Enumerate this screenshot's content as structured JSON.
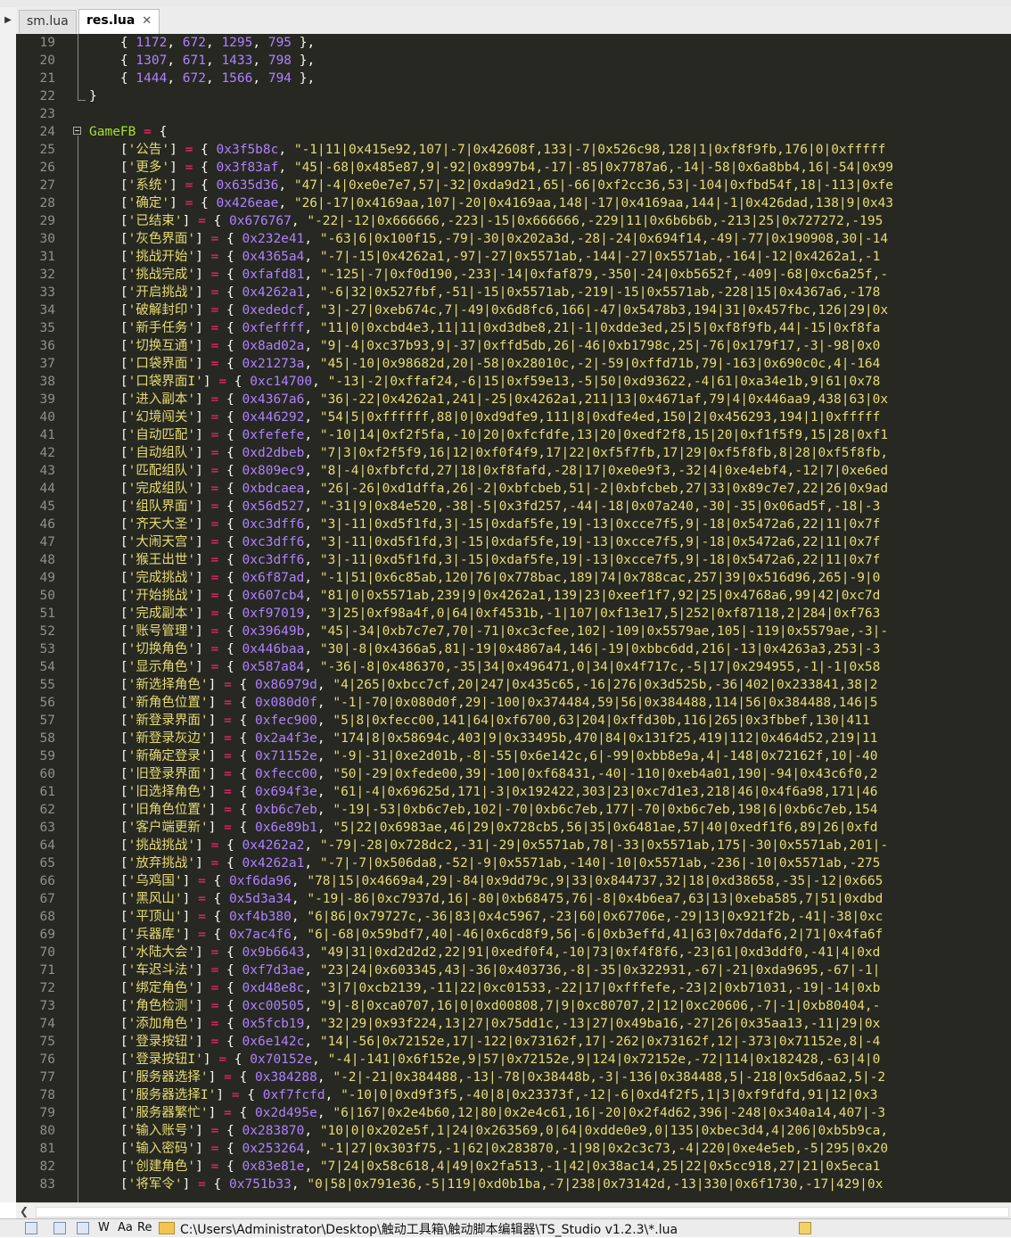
{
  "tabs": [
    {
      "label": "sm.lua",
      "active": false
    },
    {
      "label": "res.lua",
      "active": true,
      "close": "✕"
    }
  ],
  "editor": {
    "lines": [
      {
        "n": "19",
        "t": "    { 1172, 672, 1295, 795 },"
      },
      {
        "n": "20",
        "t": "    { 1307, 671, 1433, 798 },"
      },
      {
        "n": "21",
        "t": "    { 1444, 672, 1566, 794 },"
      },
      {
        "n": "22",
        "t": "}"
      },
      {
        "n": "23",
        "t": ""
      },
      {
        "n": "24",
        "t": "GameFB = {"
      },
      {
        "n": "25",
        "t": "    ['公告'] = { 0x3f5b8c, \"-1|11|0x415e92,107|-7|0x42608f,133|-7|0x526c98,128|1|0xf8f9fb,176|0|0xfffff"
      },
      {
        "n": "26",
        "t": "    ['更多'] = { 0x3f83af, \"45|-68|0x485e87,9|-92|0x8997b4,-17|-85|0x7787a6,-14|-58|0x6a8bb4,16|-54|0x99"
      },
      {
        "n": "27",
        "t": "    ['系统'] = { 0x635d36, \"47|-4|0xe0e7e7,57|-32|0xda9d21,65|-66|0xf2cc36,53|-104|0xfbd54f,18|-113|0xfe"
      },
      {
        "n": "28",
        "t": "    ['确定'] = { 0x426eae, \"26|-17|0x4169aa,107|-20|0x4169aa,148|-17|0x4169aa,144|-1|0x426dad,138|9|0x43"
      },
      {
        "n": "29",
        "t": "    ['已结束'] = { 0x676767, \"-22|-12|0x666666,-223|-15|0x666666,-229|11|0x6b6b6b,-213|25|0x727272,-195"
      },
      {
        "n": "30",
        "t": "    ['灰色界面'] = { 0x232e41, \"-63|6|0x100f15,-79|-30|0x202a3d,-28|-24|0x694f14,-49|-77|0x190908,30|-14"
      },
      {
        "n": "31",
        "t": "    ['挑战开始'] = { 0x4365a4, \"-7|-15|0x4262a1,-97|-27|0x5571ab,-144|-27|0x5571ab,-164|-12|0x4262a1,-1"
      },
      {
        "n": "32",
        "t": "    ['挑战完成'] = { 0xfafd81, \"-125|-7|0xf0d190,-233|-14|0xfaf879,-350|-24|0xb5652f,-409|-68|0xc6a25f,-"
      },
      {
        "n": "33",
        "t": "    ['开启挑战'] = { 0x4262a1, \"-6|32|0x527fbf,-51|-15|0x5571ab,-219|-15|0x5571ab,-228|15|0x4367a6,-178"
      },
      {
        "n": "34",
        "t": "    ['破解封印'] = { 0xededcf, \"3|-27|0xeb674c,7|-49|0x6d8fc6,166|-47|0x5478b3,194|31|0x457fbc,126|29|0x"
      },
      {
        "n": "35",
        "t": "    ['新手任务'] = { 0xfeffff, \"11|0|0xcbd4e3,11|11|0xd3dbe8,21|-1|0xdde3ed,25|5|0xf8f9fb,44|-15|0xf8fa"
      },
      {
        "n": "36",
        "t": "    ['切换互通'] = { 0x8ad02a, \"9|-4|0xc37b93,9|-37|0xffd5db,26|-46|0xb1798c,25|-76|0x179f17,-3|-98|0x0"
      },
      {
        "n": "37",
        "t": "    ['口袋界面'] = { 0x21273a, \"45|-10|0x98682d,20|-58|0x28010c,-2|-59|0xffd71b,79|-163|0x690c0c,4|-164"
      },
      {
        "n": "38",
        "t": "    ['口袋界面I'] = { 0xc14700, \"-13|-2|0xffaf24,-6|15|0xf59e13,-5|50|0xd93622,-4|61|0xa34e1b,9|61|0x78"
      },
      {
        "n": "39",
        "t": "    ['进入副本'] = { 0x4367a6, \"36|-22|0x4262a1,241|-25|0x4262a1,211|13|0x4671af,79|4|0x446aa9,438|63|0x"
      },
      {
        "n": "40",
        "t": "    ['幻境闯关'] = { 0x446292, \"54|5|0xffffff,88|0|0xd9dfe9,111|8|0xdfe4ed,150|2|0x456293,194|1|0xfffff"
      },
      {
        "n": "41",
        "t": "    ['自动匹配'] = { 0xfefefe, \"-10|14|0xf2f5fa,-10|20|0xfcfdfe,13|20|0xedf2f8,15|20|0xf1f5f9,15|28|0xf1"
      },
      {
        "n": "42",
        "t": "    ['自动组队'] = { 0xd2dbeb, \"7|3|0xf2f5f9,16|12|0xf0f4f9,17|22|0xf5f7fb,17|29|0xf5f8fb,8|28|0xf5f8fb,"
      },
      {
        "n": "43",
        "t": "    ['匹配组队'] = { 0x809ec9, \"8|-4|0xfbfcfd,27|18|0xf8fafd,-28|17|0xe0e9f3,-32|4|0xe4ebf4,-12|7|0xe6ed"
      },
      {
        "n": "44",
        "t": "    ['完成组队'] = { 0xbdcaea, \"26|-26|0xd1dffa,26|-2|0xbfcbeb,51|-2|0xbfcbeb,27|33|0x89c7e7,22|26|0x9ad"
      },
      {
        "n": "45",
        "t": "    ['组队界面'] = { 0x56d527, \"-31|9|0x84e520,-38|-5|0x3fd257,-44|-18|0x07a240,-30|-35|0x06ad5f,-18|-3"
      },
      {
        "n": "46",
        "t": "    ['齐天大圣'] = { 0xc3dff6, \"3|-11|0xd5f1fd,3|-15|0xdaf5fe,19|-13|0xcce7f5,9|-18|0x5472a6,22|11|0x7f"
      },
      {
        "n": "47",
        "t": "    ['大闹天宫'] = { 0xc3dff6, \"3|-11|0xd5f1fd,3|-15|0xdaf5fe,19|-13|0xcce7f5,9|-18|0x5472a6,22|11|0x7f"
      },
      {
        "n": "48",
        "t": "    ['猴王出世'] = { 0xc3dff6, \"3|-11|0xd5f1fd,3|-15|0xdaf5fe,19|-13|0xcce7f5,9|-18|0x5472a6,22|11|0x7f"
      },
      {
        "n": "49",
        "t": "    ['完成挑战'] = { 0x6f87ad, \"-1|51|0x6c85ab,120|76|0x778bac,189|74|0x788cac,257|39|0x516d96,265|-9|0"
      },
      {
        "n": "50",
        "t": "    ['开始挑战'] = { 0x607cb4, \"81|0|0x5571ab,239|9|0x4262a1,139|23|0xeef1f7,92|25|0x4768a6,99|42|0xc7d"
      },
      {
        "n": "51",
        "t": "    ['完成副本'] = { 0xf97019, \"3|25|0xf98a4f,0|64|0xf4531b,-1|107|0xf13e17,5|252|0xf87118,2|284|0xf763"
      },
      {
        "n": "52",
        "t": "    ['账号管理'] = { 0x39649b, \"45|-34|0xb7c7e7,70|-71|0xc3cfee,102|-109|0x5579ae,105|-119|0x5579ae,-3|-"
      },
      {
        "n": "53",
        "t": "    ['切换角色'] = { 0x446baa, \"30|-8|0x4366a5,81|-19|0x4867a4,146|-19|0xbbc6dd,216|-13|0x4263a3,253|-3"
      },
      {
        "n": "54",
        "t": "    ['显示角色'] = { 0x587a84, \"-36|-8|0x486370,-35|34|0x496471,0|34|0x4f717c,-5|17|0x294955,-1|-1|0x58"
      },
      {
        "n": "55",
        "t": "    ['新选择角色'] = { 0x86979d, \"4|265|0xbcc7cf,20|247|0x435c65,-16|276|0x3d525b,-36|402|0x233841,38|2"
      },
      {
        "n": "56",
        "t": "    ['新角色位置'] = { 0x080d0f, \"-1|-70|0x080d0f,29|-100|0x374484,59|56|0x384488,114|56|0x384488,146|5"
      },
      {
        "n": "57",
        "t": "    ['新登录界面'] = { 0xfec900, \"5|8|0xfecc00,141|64|0xf6700,63|204|0xffd30b,116|265|0x3fbbef,130|411"
      },
      {
        "n": "58",
        "t": "    ['新登录灰边'] = { 0x2a4f3e, \"174|8|0x58694c,403|9|0x33495b,470|84|0x131f25,419|112|0x464d52,219|11"
      },
      {
        "n": "59",
        "t": "    ['新确定登录'] = { 0x71152e, \"-9|-31|0xe2d01b,-8|-55|0x6e142c,6|-99|0xbb8e9a,4|-148|0x72162f,10|-40"
      },
      {
        "n": "60",
        "t": "    ['旧登录界面'] = { 0xfecc00, \"50|-29|0xfede00,39|-100|0xf68431,-40|-110|0xeb4a01,190|-94|0x43c6f0,2"
      },
      {
        "n": "61",
        "t": "    ['旧选择角色'] = { 0x694f3e, \"61|-4|0x69625d,171|-3|0x192422,303|23|0xc7d1e3,218|46|0x4f6a98,171|46"
      },
      {
        "n": "62",
        "t": "    ['旧角色位置'] = { 0xb6c7eb, \"-19|-53|0xb6c7eb,102|-70|0xb6c7eb,177|-70|0xb6c7eb,198|6|0xb6c7eb,154"
      },
      {
        "n": "63",
        "t": "    ['客户端更新'] = { 0x6e89b1, \"5|22|0x6983ae,46|29|0x728cb5,56|35|0x6481ae,57|40|0xedf1f6,89|26|0xfd"
      },
      {
        "n": "64",
        "t": "    ['挑战挑战'] = { 0x4262a2, \"-79|-28|0x728dc2,-31|-29|0x5571ab,78|-33|0x5571ab,175|-30|0x5571ab,201|-"
      },
      {
        "n": "65",
        "t": "    ['放弃挑战'] = { 0x4262a1, \"-7|-7|0x506da8,-52|-9|0x5571ab,-140|-10|0x5571ab,-236|-10|0x5571ab,-275"
      },
      {
        "n": "66",
        "t": "    ['乌鸡国'] = { 0xf6da96, \"78|15|0x4669a4,29|-84|0x9dd79c,9|33|0x844737,32|18|0xd38658,-35|-12|0x665"
      },
      {
        "n": "67",
        "t": "    ['黑风山'] = { 0x5d3a34, \"-19|-86|0xc7937d,16|-80|0xb68475,76|-8|0x4b6ea7,63|13|0xeba585,7|51|0xdbd"
      },
      {
        "n": "68",
        "t": "    ['平顶山'] = { 0xf4b380, \"6|86|0x79727c,-36|83|0x4c5967,-23|60|0x67706e,-29|13|0x921f2b,-41|-38|0xc"
      },
      {
        "n": "69",
        "t": "    ['兵器库'] = { 0x7ac4f6, \"6|-68|0x59bdf7,40|-46|0x6cd8f9,56|-6|0xb3effd,41|63|0x7ddaf6,2|71|0x4fa6f"
      },
      {
        "n": "70",
        "t": "    ['水陆大会'] = { 0x9b6643, \"49|31|0xd2d2d2,22|91|0xedf0f4,-10|73|0xf4f8f6,-23|61|0xd3ddf0,-41|4|0xd"
      },
      {
        "n": "71",
        "t": "    ['车迟斗法'] = { 0xf7d3ae, \"23|24|0x603345,43|-36|0x403736,-8|-35|0x322931,-67|-21|0xda9695,-67|-1|"
      },
      {
        "n": "72",
        "t": "    ['绑定角色'] = { 0xd48e8c, \"3|7|0xcb2139,-11|22|0xc01533,-22|17|0xfffefe,-23|2|0xb71031,-19|-14|0xb"
      },
      {
        "n": "73",
        "t": "    ['角色检测'] = { 0xc00505, \"9|-8|0xca0707,16|0|0xd00808,7|9|0xc80707,2|12|0xc20606,-7|-1|0xb80404,-"
      },
      {
        "n": "74",
        "t": "    ['添加角色'] = { 0x5fcb19, \"32|29|0x93f224,13|27|0x75dd1c,-13|27|0x49ba16,-27|26|0x35aa13,-11|29|0x"
      },
      {
        "n": "75",
        "t": "    ['登录按钮'] = { 0x6e142c, \"14|-56|0x72152e,17|-122|0x73162f,17|-262|0x73162f,12|-373|0x71152e,8|-4"
      },
      {
        "n": "76",
        "t": "    ['登录按钮I'] = { 0x70152e, \"-4|-141|0x6f152e,9|57|0x72152e,9|124|0x72152e,-72|114|0x182428,-63|4|0"
      },
      {
        "n": "77",
        "t": "    ['服务器选择'] = { 0x384288, \"-2|-21|0x384488,-13|-78|0x38448b,-3|-136|0x384488,5|-218|0x5d6aa2,5|-2"
      },
      {
        "n": "78",
        "t": "    ['服务器选择I'] = { 0xf7fcfd, \"-10|0|0xd9f3f5,-40|8|0x23373f,-12|-6|0xd4f2f5,1|3|0xf9fdfd,91|12|0x3"
      },
      {
        "n": "79",
        "t": "    ['服务器繁忙'] = { 0x2d495e, \"6|167|0x2e4b60,12|80|0x2e4c61,16|-20|0x2f4d62,396|-248|0x340a14,407|-3"
      },
      {
        "n": "80",
        "t": "    ['输入账号'] = { 0x283870, \"10|0|0x202e5f,1|24|0x263569,0|64|0xdde0e9,0|135|0xbec3d4,4|206|0xb5b9ca,"
      },
      {
        "n": "81",
        "t": "    ['输入密码'] = { 0x253264, \"-1|27|0x303f75,-1|62|0x283870,-1|98|0x2c3c73,-4|220|0xe4e5eb,-5|295|0x20"
      },
      {
        "n": "82",
        "t": "    ['创建角色'] = { 0x83e81e, \"7|24|0x58c618,4|49|0x2fa513,-1|42|0x38ac14,25|22|0x5cc918,27|21|0x5eca1"
      },
      {
        "n": "83",
        "t": "    ['将军令'] = { 0x751b33, \"0|58|0x791e36,-5|119|0xd0b1ba,-7|238|0x73142d,-13|330|0x6f1730,-17|429|0x"
      }
    ]
  },
  "statusbar": {
    "items": [
      "W",
      "Aa",
      "Re"
    ],
    "path": "C:\\Users\\Administrator\\Desktop\\触动工具箱\\触动脚本编辑器\\TS_Studio v1.2.3\\*.lua"
  }
}
